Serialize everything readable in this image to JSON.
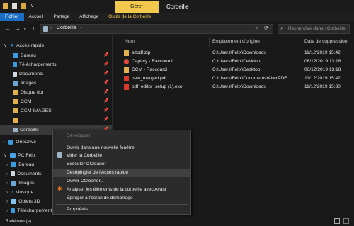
{
  "window": {
    "ribbon_context_tab": "Gérer",
    "title": "Corbeille"
  },
  "ribbon": {
    "tabs": [
      "Fichier",
      "Accueil",
      "Partage",
      "Affichage",
      "Outils de la Corbeille"
    ]
  },
  "addressbar": {
    "path": "Corbeille",
    "search_placeholder": "Rechercher dans : Corbeille"
  },
  "nav": {
    "quick_access": "Accès rapide",
    "quick_items": [
      "Bureau",
      "Téléchargements",
      "Documents",
      "Images",
      "Disque dur",
      "CCM",
      "CCM IMAGES",
      "",
      "Corbeille"
    ],
    "onedrive": "OneDrive",
    "pc": "PC Félix",
    "pc_items": [
      "Bureau",
      "Documents",
      "Images",
      "Musique",
      "Objets 3D",
      "Téléchargements"
    ]
  },
  "columns": {
    "name": "Nom",
    "location": "Emplacement d'origine",
    "deleted": "Date de suppression"
  },
  "files": [
    {
      "name": "altpdf.zip",
      "location": "C:\\Users\\Félix\\Downloads",
      "date": "11/12/2019 15:42"
    },
    {
      "name": "Captvty - Raccourci",
      "location": "C:\\Users\\Félix\\Desktop",
      "date": "06/12/2019 13:18"
    },
    {
      "name": "CCM - Raccourci",
      "location": "C:\\Users\\Félix\\Desktop",
      "date": "06/12/2019 13:18"
    },
    {
      "name": "new_merged.pdf",
      "location": "C:\\Users\\Félix\\Documents\\AlterPDF",
      "date": "11/12/2019 15:42"
    },
    {
      "name": "pdf_editor_setup (1).exe",
      "location": "C:\\Users\\Félix\\Downloads",
      "date": "11/12/2019 15:30"
    }
  ],
  "status": {
    "count": "5 élément(s)"
  },
  "context_menu": {
    "items": [
      "Développer",
      "Ouvrir dans une nouvelle fenêtre",
      "Vider la Corbeille",
      "Exécuter CCleaner",
      "Désépingler de l'Accès rapide",
      "Ouvrir CCleaner...",
      "Analyser les éléments de la corbeille avec Avast",
      "Épingler à l'écran de démarrage",
      "Propriétés"
    ]
  },
  "colors": {
    "accent": "#1a6fc5",
    "context_tab": "#f2c94c",
    "background": "#191919"
  }
}
